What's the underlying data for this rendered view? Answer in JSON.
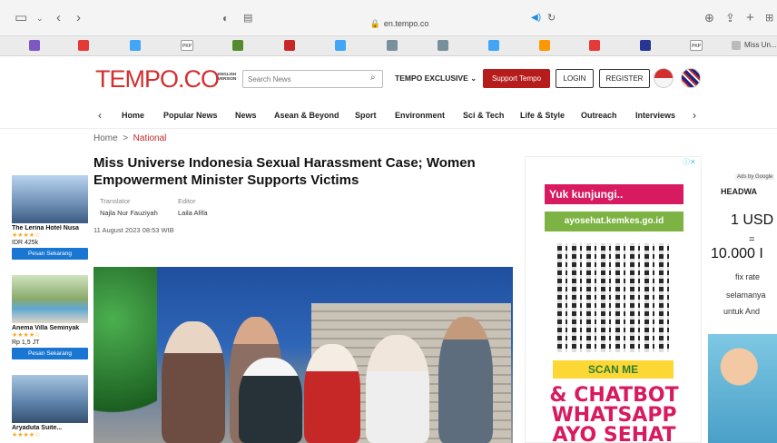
{
  "browser": {
    "url": "en.tempo.co",
    "favorites": [
      {
        "label": "",
        "color": "#7e57c2"
      },
      {
        "label": "",
        "color": "#e53935"
      },
      {
        "label": "",
        "color": "#42a5f5"
      },
      {
        "label": "PKP",
        "color": "#ffffff"
      },
      {
        "label": "",
        "color": "#558b2f"
      },
      {
        "label": "",
        "color": "#c62828"
      },
      {
        "label": "",
        "color": "#42a5f5"
      },
      {
        "label": "",
        "color": "#78909c"
      },
      {
        "label": "",
        "color": "#78909c"
      },
      {
        "label": "",
        "color": "#42a5f5"
      },
      {
        "label": "",
        "color": "#ff9800"
      },
      {
        "label": "",
        "color": "#e53935"
      },
      {
        "label": "",
        "color": "#283593"
      },
      {
        "label": "PKP",
        "color": "#ffffff"
      }
    ],
    "last_fav_label": "Miss Un..."
  },
  "header": {
    "logo": "TEMPO.CO",
    "logo_sub": "ENGLISH VERSION",
    "search_placeholder": "Search News",
    "exclusive": "TEMPO EXCLUSIVE ⌄",
    "support": "Support Tempo",
    "login": "LOGIN",
    "register": "REGISTER"
  },
  "nav": {
    "items": [
      "Home",
      "Popular News",
      "News",
      "Asean & Beyond",
      "Sport",
      "Environment",
      "Sci & Tech",
      "Life & Style",
      "Outreach",
      "Interviews"
    ]
  },
  "breadcrumb": {
    "home": "Home",
    "sep": ">",
    "current": "National"
  },
  "article": {
    "title": "Miss Universe Indonesia Sexual Harassment Case; Women Empowerment Minister Supports Victims",
    "translator_label": "Translator",
    "translator": "Najla Nur Fauziyah",
    "editor_label": "Editor",
    "editor": "Laila Afifa",
    "date": "11 August 2023 08:53 WIB"
  },
  "hotels": [
    {
      "name": "The Lerina Hotel Nusa",
      "stars": "★★★★☆",
      "price": "IDR 425k",
      "book": "Pesan Sekarang",
      "color": "#6d8fb3"
    },
    {
      "name": "Anema Villa Seminyak",
      "stars": "★★★★☆",
      "price": "Rp 1,5 JT",
      "book": "Pesan Sekarang",
      "color": "#8aaa6a"
    },
    {
      "name": "Aryaduta Suite...",
      "stars": "★★★★☆",
      "price": "",
      "book": "",
      "color": "#5a7fa8"
    }
  ],
  "ad_left": {
    "line1": "Yuk kunjungi..",
    "line2": "ayosehat.kemkes.go.id",
    "scan": "SCAN ME",
    "chat1": "& CHATBOT",
    "chat2": "WHATSAPP",
    "chat3": "AYO SEHAT"
  },
  "ad_right": {
    "tag": "Ads by Google",
    "brand": "HEADWA",
    "usd": "1 USD",
    "eq": "=",
    "idr": "10.000 I",
    "fix": "fix rate",
    "sel": "selamanya",
    "unt": "untuk And"
  }
}
